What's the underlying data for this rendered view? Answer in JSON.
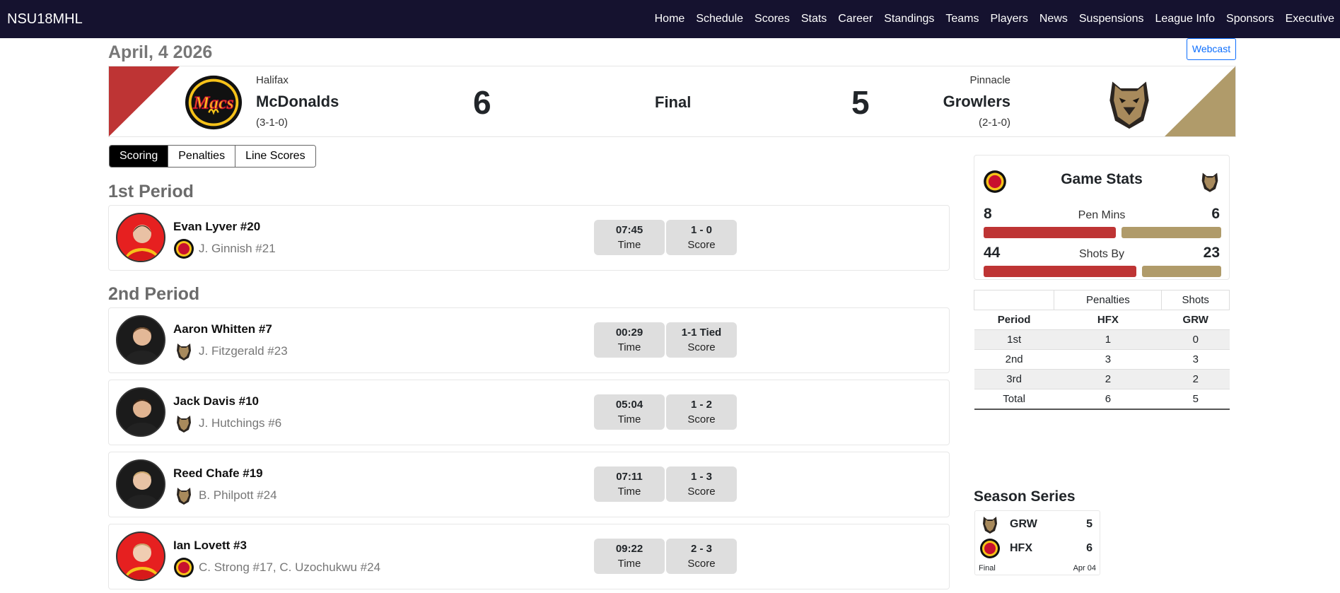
{
  "nav": {
    "brand": "NSU18MHL",
    "links": [
      "Home",
      "Schedule",
      "Scores",
      "Stats",
      "Career",
      "Standings",
      "Teams",
      "Players",
      "News",
      "Suspensions",
      "League Info",
      "Sponsors",
      "Executive"
    ]
  },
  "game": {
    "date": "April, 4 2026",
    "webcast_label": "Webcast",
    "status": "Final",
    "home": {
      "city": "Halifax",
      "name": "McDonalds",
      "record": "(3-1-0)",
      "score": "6",
      "color": "#be3434",
      "logo_text": "Macs"
    },
    "away": {
      "city": "Pinnacle",
      "name": "Growlers",
      "record": "(2-1-0)",
      "score": "5",
      "color": "#b09b6a"
    }
  },
  "tabs": [
    "Scoring",
    "Penalties",
    "Line Scores"
  ],
  "periods": [
    {
      "title": "1st Period",
      "goals": [
        {
          "scorer": "Evan Lyver #20",
          "assists": "J. Ginnish #21",
          "team": "home",
          "time": "07:45",
          "time_label": "Time",
          "score": "1 - 0",
          "score_label": "Score"
        }
      ]
    },
    {
      "title": "2nd Period",
      "goals": [
        {
          "scorer": "Aaron Whitten #7",
          "assists": "J. Fitzgerald #23",
          "team": "away",
          "time": "00:29",
          "time_label": "Time",
          "score": "1-1 Tied",
          "score_label": "Score"
        },
        {
          "scorer": "Jack Davis #10",
          "assists": "J. Hutchings #6",
          "team": "away",
          "time": "05:04",
          "time_label": "Time",
          "score": "1 - 2",
          "score_label": "Score"
        },
        {
          "scorer": "Reed Chafe #19",
          "assists": "B. Philpott #24",
          "team": "away",
          "time": "07:11",
          "time_label": "Time",
          "score": "1 - 3",
          "score_label": "Score"
        },
        {
          "scorer": "Ian Lovett #3",
          "assists": "C. Strong #17, C. Uzochukwu #24",
          "team": "home",
          "time": "09:22",
          "time_label": "Time",
          "score": "2 - 3",
          "score_label": "Score"
        }
      ]
    }
  ],
  "game_stats": {
    "title": "Game Stats",
    "pen_mins": {
      "label": "Pen Mins",
      "home": "8",
      "away": "6",
      "home_frac": 0.57
    },
    "shots": {
      "label": "Shots By",
      "home": "44",
      "away": "23",
      "home_frac": 0.66
    }
  },
  "line_scores": {
    "group_headers": [
      "",
      "Penalties",
      "Shots"
    ],
    "columns": [
      "Period",
      "HFX",
      "GRW"
    ],
    "rows": [
      [
        "1st",
        "1",
        "0"
      ],
      [
        "2nd",
        "3",
        "3"
      ],
      [
        "3rd",
        "2",
        "2"
      ],
      [
        "Total",
        "6",
        "5"
      ]
    ]
  },
  "season_series": {
    "title": "Season Series",
    "teams": [
      {
        "abbr": "GRW",
        "score": "5"
      },
      {
        "abbr": "HFX",
        "score": "6"
      }
    ],
    "status": "Final",
    "date": "Apr 04"
  }
}
